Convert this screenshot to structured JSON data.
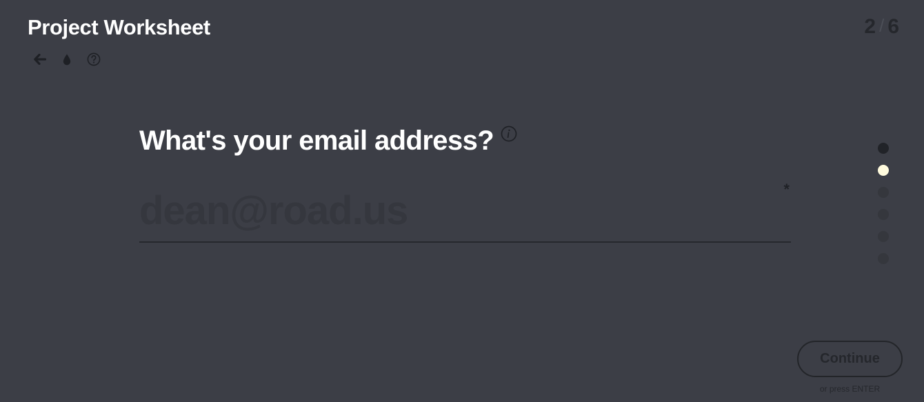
{
  "header": {
    "title": "Project Worksheet",
    "counter": {
      "current": "2",
      "separator": "/",
      "total": "6"
    }
  },
  "toolbar": {
    "items": [
      {
        "icon": "arrow-left-icon",
        "action": "back"
      },
      {
        "icon": "droplet-icon",
        "action": "theme"
      },
      {
        "icon": "help-circle-icon",
        "action": "help"
      }
    ]
  },
  "question": {
    "text": "What's your email address?",
    "info_icon": "info-icon",
    "required_mark": "*"
  },
  "email_field": {
    "value": "",
    "placeholder": "dean@road.us"
  },
  "progress": {
    "current_step": 2,
    "total_steps": 6,
    "dot_colors": [
      "#212328",
      "#fffbde",
      "#35373d",
      "#35373d",
      "#35373d",
      "#35373d"
    ]
  },
  "actions": {
    "continue_label": "Continue",
    "hint": "or press ENTER"
  },
  "colors": {
    "background": "#3c3e46",
    "title_text": "#ffffff",
    "muted_text": "#25272c",
    "active_dot": "#fffbde"
  }
}
